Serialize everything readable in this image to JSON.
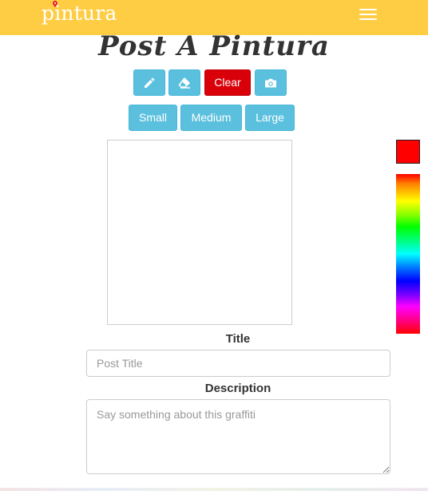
{
  "navbar": {
    "brand": "pintura",
    "colors": {
      "background": "#ffcd44",
      "brand_text": "#ffffff",
      "pin": "#e8232a"
    }
  },
  "page": {
    "title": "Post A Pintura"
  },
  "toolbar": {
    "pencil_icon": "pencil-icon",
    "eraser_icon": "eraser-icon",
    "clear_label": "Clear",
    "camera_icon": "camera-icon",
    "colors": {
      "button": "#5bc0de",
      "clear_button": "#d9000a"
    }
  },
  "brush_sizes": {
    "small": "Small",
    "medium": "Medium",
    "large": "Large"
  },
  "color_picker": {
    "selected_color": "#ff0000"
  },
  "form": {
    "title_label": "Title",
    "title_placeholder": "Post Title",
    "description_label": "Description",
    "description_placeholder": "Say something about this graffiti"
  }
}
